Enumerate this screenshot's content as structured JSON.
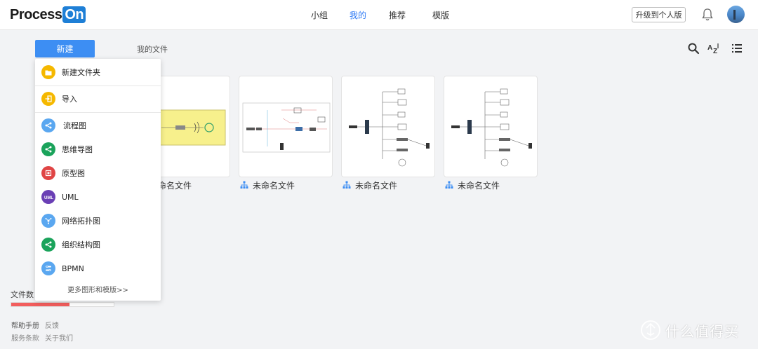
{
  "header": {
    "logo_text_1": "Process",
    "logo_text_2": "On",
    "nav": [
      "小组",
      "我的",
      "推荐",
      "模版"
    ],
    "active_nav": 1,
    "upgrade_label": "升级到个人版"
  },
  "toolbar": {
    "new_label": "新建",
    "breadcrumb": "我的文件"
  },
  "menu": {
    "items": [
      {
        "label": "新建文件夹",
        "icon": "folder-icon",
        "color": "#f5b800"
      },
      {
        "label": "导入",
        "icon": "import-icon",
        "color": "#f5b800"
      },
      {
        "label": "流程图",
        "icon": "share-icon",
        "color": "#5aa7f0"
      },
      {
        "label": "思维导图",
        "icon": "mindmap-icon",
        "color": "#1aa35b"
      },
      {
        "label": "原型图",
        "icon": "prototype-icon",
        "color": "#e04545"
      },
      {
        "label": "UML",
        "icon": "uml-icon",
        "color": "#6a3fb5"
      },
      {
        "label": "网络拓扑图",
        "icon": "network-icon",
        "color": "#5aa7f0"
      },
      {
        "label": "组织结构图",
        "icon": "org-icon",
        "color": "#1aa35b"
      },
      {
        "label": "BPMN",
        "icon": "bpmn-icon",
        "color": "#5aa7f0"
      }
    ],
    "more_label": "更多图形和模版>>"
  },
  "files": [
    {
      "name": "未命名文件",
      "visible_name": "命名文件"
    },
    {
      "name": "未命名文件"
    },
    {
      "name": "未命名文件"
    },
    {
      "name": "未命名文件"
    }
  ],
  "sidebar": {
    "file_count_label": "文件数：",
    "usage_fraction": 0.57,
    "links": [
      "帮助手册",
      "反馈",
      "服务条款",
      "关于我们"
    ]
  },
  "watermark": "什么值得买",
  "colors": {
    "accent": "#3d8ef3",
    "progress": "#f25d5d"
  }
}
